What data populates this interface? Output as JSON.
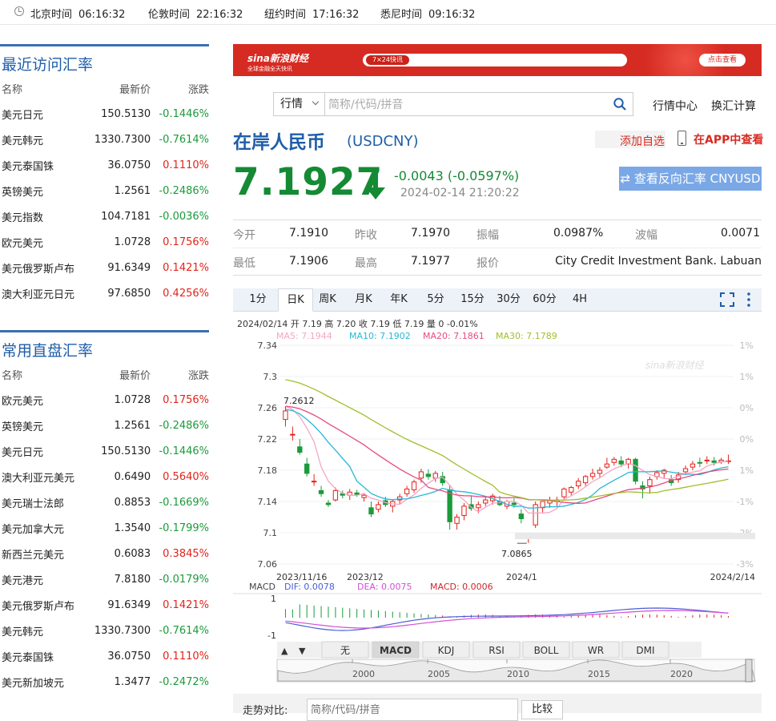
{
  "clocks": [
    {
      "city": "北京时间",
      "time": "06:16:32"
    },
    {
      "city": "伦敦时间",
      "time": "22:16:32"
    },
    {
      "city": "纽约时间",
      "time": "17:16:32"
    },
    {
      "city": "悉尼时间",
      "time": "09:16:32"
    }
  ],
  "recent": {
    "title": "最近访问汇率",
    "headers": [
      "名称",
      "最新价",
      "涨跌"
    ],
    "rows": [
      {
        "name": "美元日元",
        "price": "150.5130",
        "chg": "-0.1446%",
        "dir": "down"
      },
      {
        "name": "美元韩元",
        "price": "1330.7300",
        "chg": "-0.7614%",
        "dir": "down"
      },
      {
        "name": "美元泰国铢",
        "price": "36.0750",
        "chg": "0.1110%",
        "dir": "up"
      },
      {
        "name": "英镑美元",
        "price": "1.2561",
        "chg": "-0.2486%",
        "dir": "down"
      },
      {
        "name": "美元指数",
        "price": "104.7181",
        "chg": "-0.0036%",
        "dir": "down"
      },
      {
        "name": "欧元美元",
        "price": "1.0728",
        "chg": "0.1756%",
        "dir": "up"
      },
      {
        "name": "美元俄罗斯卢布",
        "price": "91.6349",
        "chg": "0.1421%",
        "dir": "up"
      },
      {
        "name": "澳大利亚元日元",
        "price": "97.6850",
        "chg": "0.4256%",
        "dir": "up"
      }
    ]
  },
  "direct": {
    "title": "常用直盘汇率",
    "headers": [
      "名称",
      "最新价",
      "涨跌"
    ],
    "rows": [
      {
        "name": "欧元美元",
        "price": "1.0728",
        "chg": "0.1756%",
        "dir": "up"
      },
      {
        "name": "英镑美元",
        "price": "1.2561",
        "chg": "-0.2486%",
        "dir": "down"
      },
      {
        "name": "美元日元",
        "price": "150.5130",
        "chg": "-0.1446%",
        "dir": "down"
      },
      {
        "name": "澳大利亚元美元",
        "price": "0.6490",
        "chg": "0.5640%",
        "dir": "up"
      },
      {
        "name": "美元瑞士法郎",
        "price": "0.8853",
        "chg": "-0.1669%",
        "dir": "down"
      },
      {
        "name": "美元加拿大元",
        "price": "1.3540",
        "chg": "-0.1799%",
        "dir": "down"
      },
      {
        "name": "新西兰元美元",
        "price": "0.6083",
        "chg": "0.3845%",
        "dir": "up"
      },
      {
        "name": "美元港元",
        "price": "7.8180",
        "chg": "-0.0179%",
        "dir": "down"
      },
      {
        "name": "美元俄罗斯卢布",
        "price": "91.6349",
        "chg": "0.1421%",
        "dir": "up"
      },
      {
        "name": "美元韩元",
        "price": "1330.7300",
        "chg": "-0.7614%",
        "dir": "down"
      },
      {
        "name": "美元泰国铢",
        "price": "36.0750",
        "chg": "0.1110%",
        "dir": "up"
      },
      {
        "name": "美元新加坡元",
        "price": "1.3477",
        "chg": "-0.2472%",
        "dir": "down"
      }
    ]
  },
  "banner": {
    "logo": "sina新浪财经",
    "logo_sub": "全球金融全天快讯",
    "pill": "7×24快讯",
    "button": "点击查看"
  },
  "search": {
    "select": "行情",
    "placeholder": "简称/代码/拼音"
  },
  "links": {
    "market": "行情中心",
    "calc": "换汇计算"
  },
  "quote": {
    "name": "在岸人民币",
    "code": "(USDCNY)",
    "add_fav": "添加自选",
    "app_view": "在APP中查看",
    "price": "7.1927",
    "change": "-0.0043 (-0.0597%)",
    "time": "2024-02-14 21:20:22",
    "reverse": "⇄ 查看反向汇率 CNYUSD"
  },
  "stats": {
    "open_l": "今开",
    "open": "7.1910",
    "prev_l": "昨收",
    "prev": "7.1970",
    "amp_l": "振幅",
    "amp": "0.0987%",
    "wave_l": "波幅",
    "wave": "0.0071",
    "low_l": "最低",
    "low": "7.1906",
    "high_l": "最高",
    "high": "7.1977",
    "quote_l": "报价",
    "quote": "City Credit Investment Bank. Labuan"
  },
  "tabs": [
    "1分",
    "日K",
    "周K",
    "月K",
    "年K",
    "5分",
    "15分",
    "30分",
    "60分",
    "4H"
  ],
  "active_tab": "日K",
  "chart_info": {
    "ohlc": "2024/02/14 开 7.19 高 7.20 收 7.19 低 7.19 量 0 -0.01%",
    "ma5": "MA5: 7.1944",
    "ma10": "MA10: 7.1902",
    "ma20": "MA20: 7.1861",
    "ma30": "MA30: 7.1789",
    "macd_label": "MACD",
    "dif": "DIF: 0.0078",
    "dea": "DEA: 0.0075",
    "macd": "MACD: 0.0006",
    "max_note": "7.2612",
    "min_note": "7.0865",
    "watermark": "sina新浪财经"
  },
  "chart_data": {
    "type": "candlestick",
    "y_ticks": [
      "7.34",
      "7.3",
      "7.26",
      "7.22",
      "7.18",
      "7.14",
      "7.1",
      "7.06"
    ],
    "ylim": [
      7.06,
      7.34
    ],
    "pct_ticks": [
      "1%",
      "1%",
      "0%",
      "0%",
      "1%",
      "-1%",
      "-2%",
      "-3%"
    ],
    "x_labels": [
      "2023/11/16",
      "2023/12",
      "2024/1",
      "2024/2/14"
    ],
    "macd_ticks": [
      "1",
      "-1"
    ],
    "max_label": 7.2612,
    "min_label": 7.0865,
    "ma5_last": 7.1944,
    "ma10_last": 7.1902,
    "ma20_last": 7.1861,
    "ma30_last": 7.1789,
    "dif_last": 0.0078,
    "dea_last": 0.0075,
    "macd_last": 0.0006,
    "colors": {
      "up": "#e2231a",
      "down": "#1a9b3a",
      "ma5": "#f4a6c6",
      "ma10": "#27b8d8",
      "ma20": "#e84a7f",
      "ma30": "#9fbf2e"
    }
  },
  "indicators": [
    "无",
    "MACD",
    "KDJ",
    "RSI",
    "BOLL",
    "WR",
    "DMI"
  ],
  "active_indicator": "MACD",
  "timeline_years": [
    "2000",
    "2005",
    "2010",
    "2015",
    "2020"
  ],
  "compare": {
    "label": "走势对比:",
    "placeholder": "简称/代码/拼音",
    "button": "比较"
  }
}
